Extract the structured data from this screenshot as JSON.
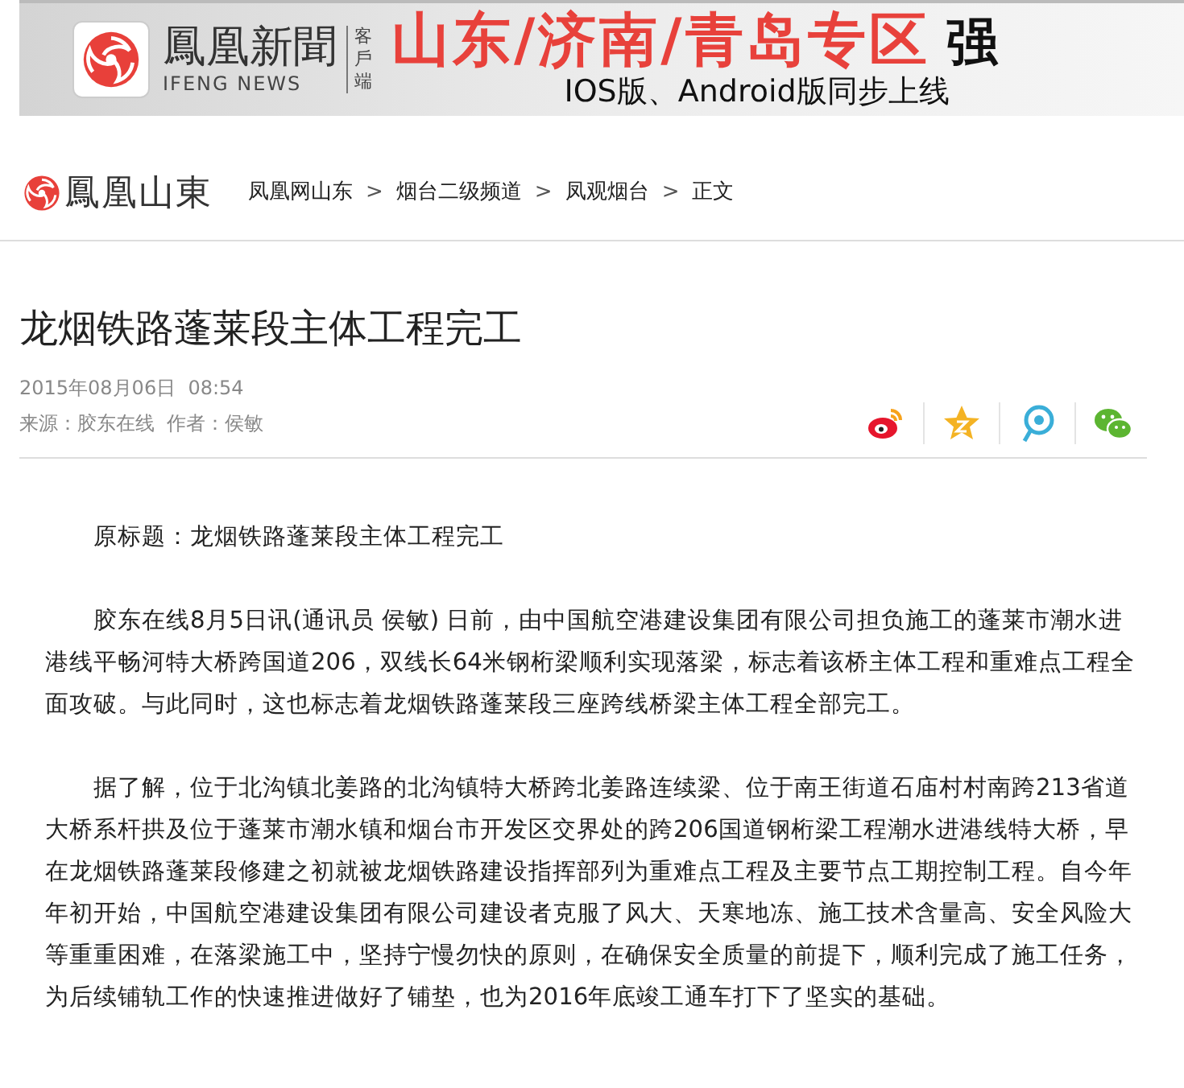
{
  "banner": {
    "brand_cn": "鳳凰新聞",
    "brand_en": "IFENG NEWS",
    "client_label": "客戶端",
    "headline": "山东/济南/青岛专区",
    "headline_cut": "强",
    "subline": "IOS版、Android版同步上线"
  },
  "site": {
    "logo_text": "鳳凰山東",
    "breadcrumb": [
      {
        "label": "凤凰网山东",
        "separator": ">"
      },
      {
        "label": "烟台二级频道",
        "separator": ">"
      },
      {
        "label": "凤观烟台",
        "separator": ">"
      },
      {
        "label": "正文"
      }
    ]
  },
  "article": {
    "title": "龙烟铁路蓬莱段主体工程完工",
    "date": "2015年08月06日  08:54",
    "source": "来源：胶东在线  作者：侯敏",
    "share_icons": [
      {
        "kind": "weibo"
      },
      {
        "kind": "qzone"
      },
      {
        "kind": "tqq"
      },
      {
        "kind": "wechat"
      }
    ],
    "paragraphs": [
      "原标题：龙烟铁路蓬莱段主体工程完工",
      "胶东在线8月5日讯(通讯员 侯敏) 日前，由中国航空港建设集团有限公司担负施工的蓬莱市潮水进港线平畅河特大桥跨国道206，双线长64米钢桁梁顺利实现落梁，标志着该桥主体工程和重难点工程全面攻破。与此同时，这也标志着龙烟铁路蓬莱段三座跨线桥梁主体工程全部完工。",
      "据了解，位于北沟镇北姜路的北沟镇特大桥跨北姜路连续梁、位于南王街道石庙村村南跨213省道大桥系杆拱及位于蓬莱市潮水镇和烟台市开发区交界处的跨206国道钢桁梁工程潮水进港线特大桥，早在龙烟铁路蓬莱段修建之初就被龙烟铁路建设指挥部列为重难点工程及主要节点工期控制工程。自今年年初开始，中国航空港建设集团有限公司建设者克服了风大、天寒地冻、施工技术含量高、安全风险大等重重困难，在落梁施工中，坚持宁慢勿快的原则，在确保安全质量的前提下，顺利完成了施工任务，为后续铺轨工作的快速推进做好了铺垫，也为2016年底竣工通车打下了坚实的基础。"
    ]
  }
}
